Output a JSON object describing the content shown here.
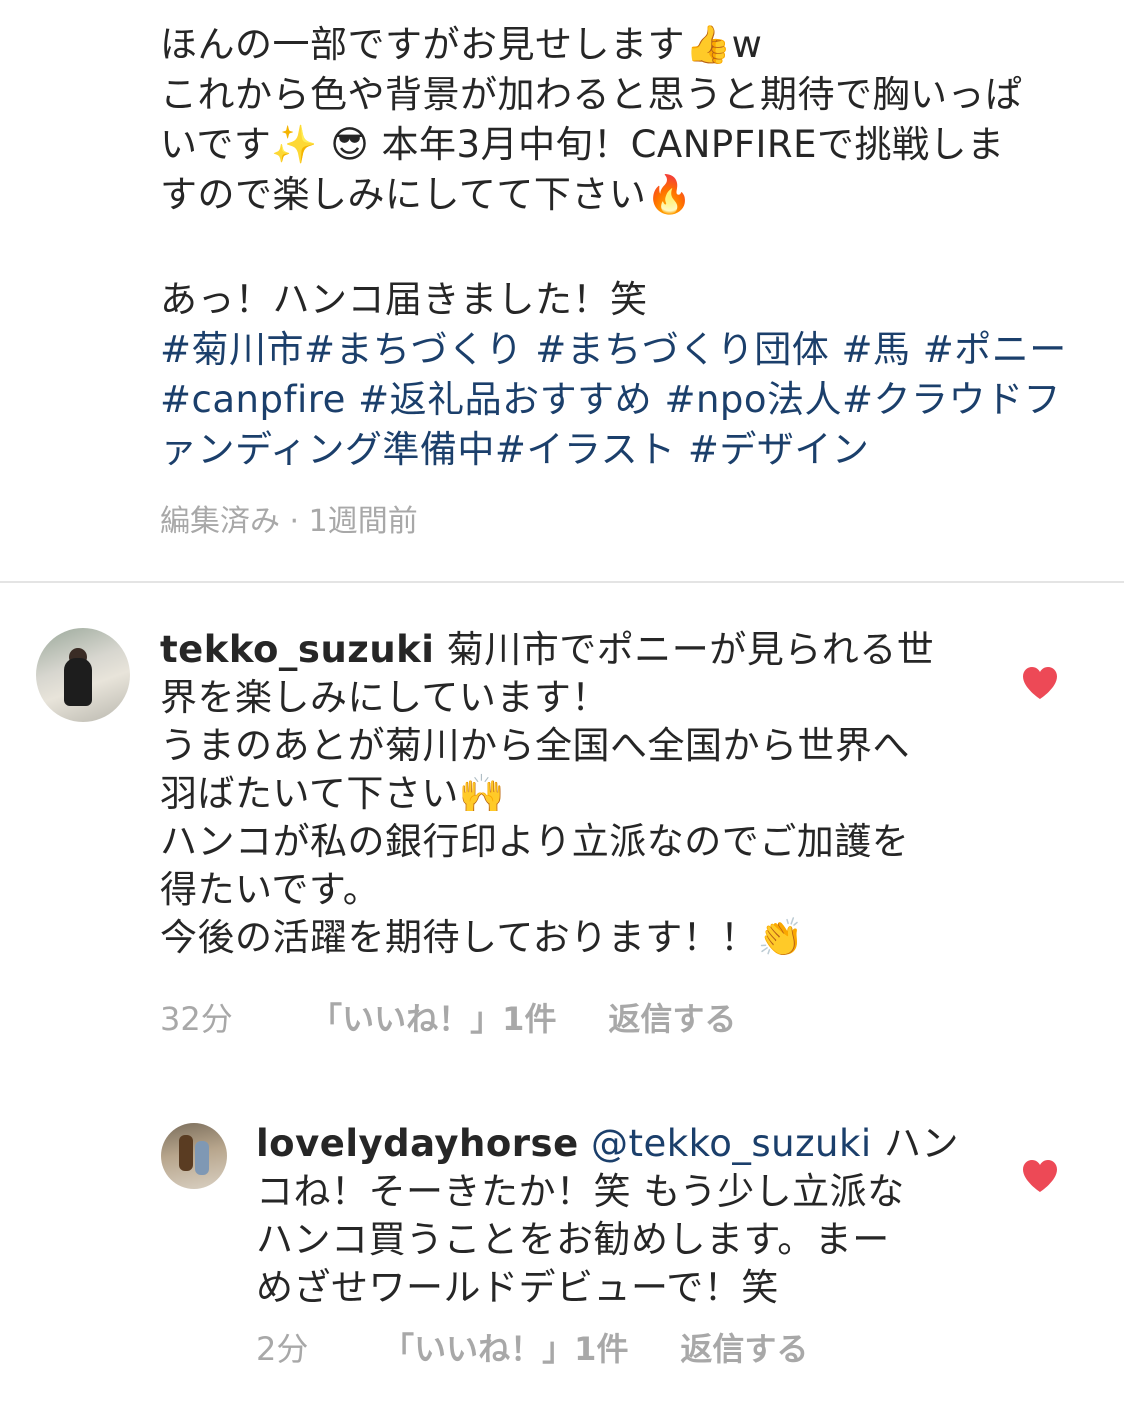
{
  "post": {
    "caption_lines": [
      "ほんの一部ですがお見せします👍w",
      "これから色や背景が加わると思うと期待で胸いっぱ",
      "いです✨ 😎 本年3月中旬！CANPFIREで挑戦しま",
      "すので楽しみにしてて下さい🔥"
    ],
    "caption_extra": "あっ！ハンコ届きました！笑",
    "hashtag_lines": [
      "#菊川市#まちづくり #まちづくり団体 #馬 #ポニー",
      "#canpfire #返礼品おすすめ #npo法人#クラウドフ",
      "ァンディング準備中#イラスト #デザイン"
    ],
    "meta": "編集済み · 1週間前"
  },
  "comments": [
    {
      "username": "tekko_suzuki",
      "lines": [
        "菊川市でポニーが見られる世",
        "界を楽しみにしています！",
        "うまのあとが菊川から全国へ全国から世界へ",
        "羽ばたいて下さい🙌",
        "ハンコが私の銀行印より立派なのでご加護を",
        "得たいです。",
        "今後の活躍を期待しております！！👏"
      ],
      "time": "32分",
      "likes": "「いいね！」1件",
      "reply": "返信する",
      "heart_color": "#ed4956"
    },
    {
      "username": "lovelydayhorse",
      "mention": "@tekko_suzuki",
      "first_line_rest": "ハン",
      "lines": [
        "コね！そーきたか！笑 もう少し立派な",
        "ハンコ買うことをお勧めします。まー",
        "めざせワールドデビューで！笑"
      ],
      "time": "2分",
      "likes": "「いいね！」1件",
      "reply": "返信する",
      "heart_color": "#ed4956"
    }
  ]
}
